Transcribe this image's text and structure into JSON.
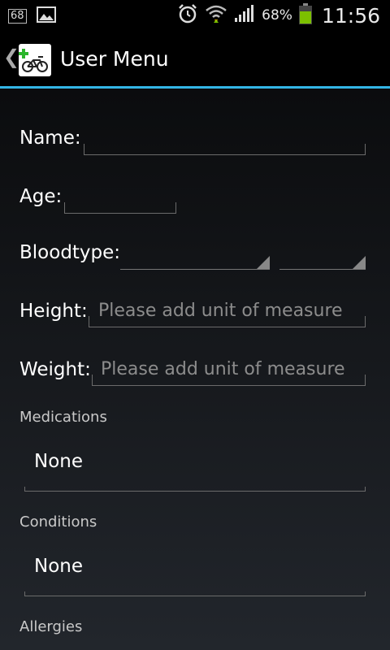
{
  "status_bar": {
    "notification_count": "68",
    "battery_percent": "68%",
    "time": "11:56"
  },
  "action_bar": {
    "title": "User Menu"
  },
  "form": {
    "name_label": "Name:",
    "age_label": "Age:",
    "bloodtype_label": "Bloodtype:",
    "height_label": "Height:",
    "height_placeholder": "Please add unit of measure",
    "weight_label": "Weight:",
    "weight_placeholder": "Please add unit of measure"
  },
  "sections": {
    "medications": {
      "header": "Medications",
      "value": "None"
    },
    "conditions": {
      "header": "Conditions",
      "value": "None"
    },
    "allergies": {
      "header": "Allergies"
    }
  },
  "colors": {
    "accent": "#33b5e5",
    "battery": "#7cc000"
  }
}
